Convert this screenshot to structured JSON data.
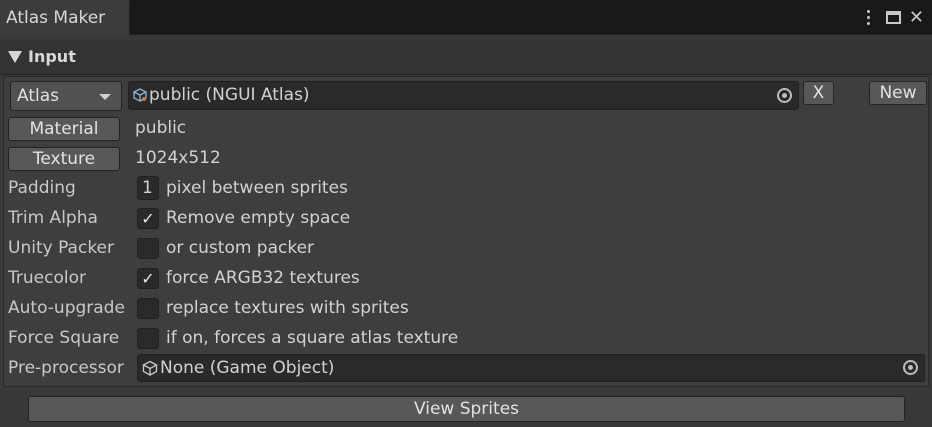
{
  "window": {
    "tab_title": "Atlas Maker",
    "icons": [
      "kebab-menu-icon",
      "maximize-icon",
      "close-icon"
    ]
  },
  "section": {
    "title": "Input",
    "expanded": true
  },
  "atlas": {
    "type_selected": "Atlas",
    "object_value": "public (NGUI Atlas)",
    "clear_label": "X",
    "new_label": "New"
  },
  "material": {
    "button_label": "Material",
    "value": "public"
  },
  "texture": {
    "button_label": "Texture",
    "value": "1024x512"
  },
  "padding": {
    "label": "Padding",
    "value": "1",
    "description": "pixel between sprites"
  },
  "options": [
    {
      "label": "Trim Alpha",
      "checked": true,
      "description": "Remove empty space"
    },
    {
      "label": "Unity Packer",
      "checked": false,
      "description": "or custom packer"
    },
    {
      "label": "Truecolor",
      "checked": true,
      "description": "force ARGB32 textures"
    },
    {
      "label": "Auto-upgrade",
      "checked": false,
      "description": "replace textures with sprites"
    },
    {
      "label": "Force Square",
      "checked": false,
      "description": "if on, forces a square atlas texture"
    }
  ],
  "preprocessor": {
    "label": "Pre-processor",
    "value": "None (Game Object)"
  },
  "view_sprites_label": "View Sprites",
  "colors": {
    "background": "#383838",
    "field": "#2a2a2a",
    "button": "#585858"
  }
}
